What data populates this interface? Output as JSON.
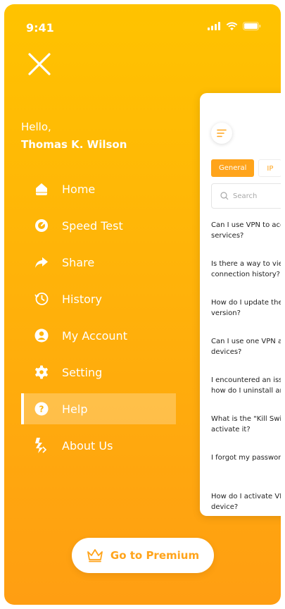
{
  "status": {
    "time": "9:41"
  },
  "greeting": {
    "hello": "Hello,",
    "user": "Thomas K. Wilson"
  },
  "menu": {
    "items": [
      {
        "label": "Home",
        "icon": "home-icon"
      },
      {
        "label": "Speed Test",
        "icon": "speedometer-icon"
      },
      {
        "label": "Share",
        "icon": "share-arrow-icon"
      },
      {
        "label": "History",
        "icon": "history-clock-icon"
      },
      {
        "label": "My Account",
        "icon": "user-icon"
      },
      {
        "label": "Setting",
        "icon": "gear-icon"
      },
      {
        "label": "Help",
        "icon": "question-icon",
        "active": true
      },
      {
        "label": "About Us",
        "icon": "brand-logo-icon"
      }
    ]
  },
  "preview": {
    "tabs": [
      "General",
      "IP"
    ],
    "search_placeholder": "Search",
    "faqs": [
      "Can I use VPN to acc\nservices?",
      "Is there a way to vie\nconnection history?",
      "How do I update the\nversion?",
      "Can I use one VPN a\ndevices?",
      "I encountered an iss\nhow do I uninstall ar",
      "What is the \"Kill Swit\nactivate it?",
      "I forgot my passwor",
      "How do I activate VP\ndevice?"
    ]
  },
  "premium": {
    "label": "Go to Premium"
  },
  "colors": {
    "accent": "#FFA41B",
    "gradient_top": "#FFC300",
    "gradient_bottom": "#FF9E12"
  }
}
